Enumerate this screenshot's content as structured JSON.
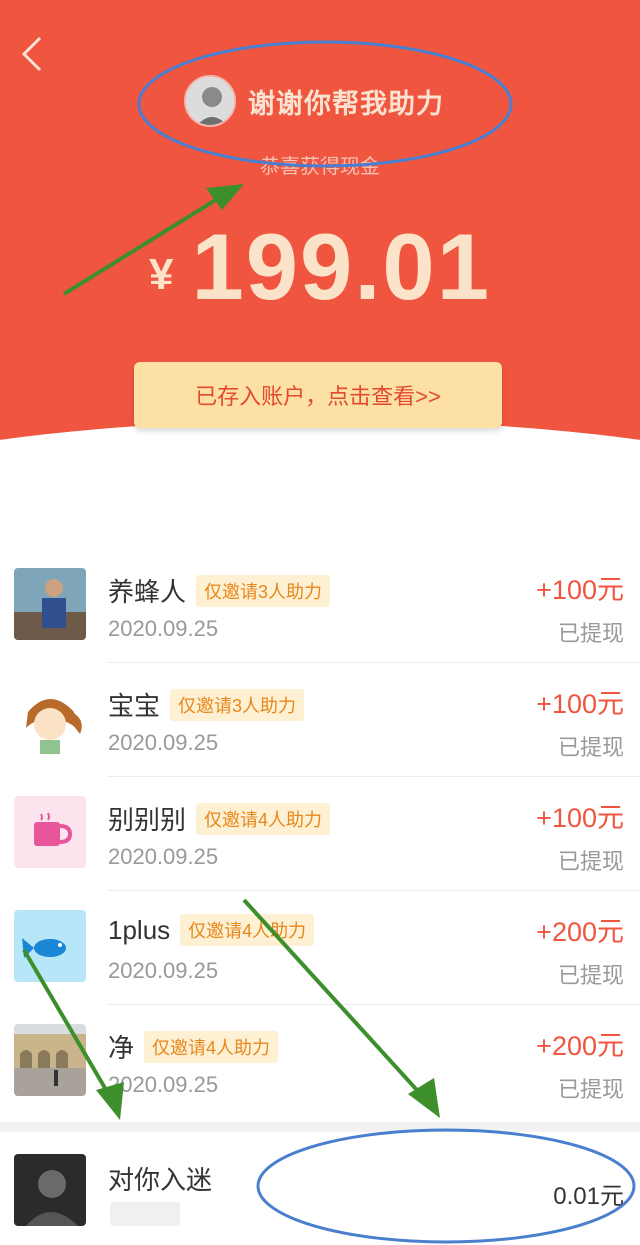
{
  "header": {
    "title": "谢谢你帮我助力",
    "subtitle": "恭喜获得现金",
    "currency": "¥",
    "amount": "199.01",
    "view_button": "已存入账户，点击查看>>"
  },
  "records": [
    {
      "name": "养蜂人",
      "tag": "仅邀请3人助力",
      "date": "2020.09.25",
      "amount": "+100元",
      "status": "已提现",
      "avatar": "photo-person-avatar"
    },
    {
      "name": "宝宝",
      "tag": "仅邀请3人助力",
      "date": "2020.09.25",
      "amount": "+100元",
      "status": "已提现",
      "avatar": "cartoon-girl-avatar"
    },
    {
      "name": "别别别",
      "tag": "仅邀请4人助力",
      "date": "2020.09.25",
      "amount": "+100元",
      "status": "已提现",
      "avatar": "pink-mug-avatar"
    },
    {
      "name": "1plus",
      "tag": "仅邀请4人助力",
      "date": "2020.09.25",
      "amount": "+200元",
      "status": "已提现",
      "avatar": "blue-fish-avatar"
    },
    {
      "name": "净",
      "tag": "仅邀请4人助力",
      "date": "2020.09.25",
      "amount": "+200元",
      "status": "已提现",
      "avatar": "arch-building-avatar"
    }
  ],
  "last_record": {
    "name": "对你入迷",
    "amount": "0.01元",
    "avatar": "dark-portrait-avatar"
  },
  "colors": {
    "header_red": "#f0553f",
    "button_yellow": "#fce0a6",
    "amount_red": "#f0553f",
    "tag_orange": "#e8871c",
    "annotation_blue": "#4a7fd0",
    "annotation_green": "#3c8f2a"
  }
}
